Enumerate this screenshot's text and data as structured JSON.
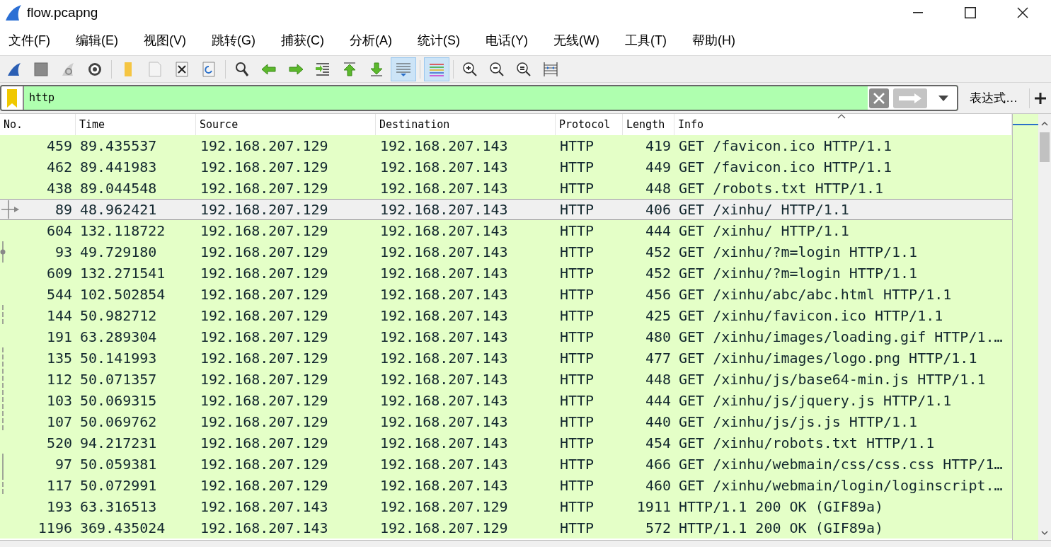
{
  "window": {
    "title": "flow.pcapng"
  },
  "menu": [
    "文件(F)",
    "编辑(E)",
    "视图(V)",
    "跳转(G)",
    "捕获(C)",
    "分析(A)",
    "统计(S)",
    "电话(Y)",
    "无线(W)",
    "工具(T)",
    "帮助(H)"
  ],
  "toolbar": [
    {
      "kind": "fin",
      "pressed": false
    },
    {
      "kind": "stop",
      "pressed": false
    },
    {
      "kind": "restart",
      "pressed": false
    },
    {
      "kind": "options",
      "pressed": false
    },
    {
      "kind": "separator"
    },
    {
      "kind": "open",
      "pressed": false
    },
    {
      "kind": "file",
      "pressed": false
    },
    {
      "kind": "close",
      "pressed": false
    },
    {
      "kind": "reload",
      "pressed": false
    },
    {
      "kind": "separator"
    },
    {
      "kind": "find",
      "pressed": false
    },
    {
      "kind": "back",
      "pressed": false
    },
    {
      "kind": "forward",
      "pressed": false
    },
    {
      "kind": "goto",
      "pressed": false
    },
    {
      "kind": "first",
      "pressed": false
    },
    {
      "kind": "last",
      "pressed": false
    },
    {
      "kind": "autoscroll",
      "pressed": true
    },
    {
      "kind": "separator"
    },
    {
      "kind": "colorize",
      "pressed": true
    },
    {
      "kind": "separator"
    },
    {
      "kind": "zoom-in",
      "pressed": false
    },
    {
      "kind": "zoom-out",
      "pressed": false
    },
    {
      "kind": "zoom-reset",
      "pressed": false
    },
    {
      "kind": "resize",
      "pressed": false
    }
  ],
  "filter": {
    "value": "http",
    "valid": true,
    "expression_button": "表达式…"
  },
  "table": {
    "columns": [
      {
        "label": "No."
      },
      {
        "label": "Time"
      },
      {
        "label": "Source"
      },
      {
        "label": "Destination"
      },
      {
        "label": "Protocol"
      },
      {
        "label": "Length"
      },
      {
        "label": "Info",
        "sorted": true
      }
    ],
    "rows": [
      {
        "no": "459",
        "time": "89.435537",
        "source": "192.168.207.129",
        "destination": "192.168.207.143",
        "protocol": "HTTP",
        "length": "419",
        "info": "GET /favicon.ico HTTP/1.1",
        "selected": false
      },
      {
        "no": "462",
        "time": "89.441983",
        "source": "192.168.207.129",
        "destination": "192.168.207.143",
        "protocol": "HTTP",
        "length": "449",
        "info": "GET /favicon.ico HTTP/1.1",
        "selected": false
      },
      {
        "no": "438",
        "time": "89.044548",
        "source": "192.168.207.129",
        "destination": "192.168.207.143",
        "protocol": "HTTP",
        "length": "448",
        "info": "GET /robots.txt HTTP/1.1",
        "selected": false
      },
      {
        "no": "89",
        "time": "48.962421",
        "source": "192.168.207.129",
        "destination": "192.168.207.143",
        "protocol": "HTTP",
        "length": "406",
        "info": "GET /xinhu/ HTTP/1.1",
        "selected": true,
        "kind": "arrow"
      },
      {
        "no": "604",
        "time": "132.118722",
        "source": "192.168.207.129",
        "destination": "192.168.207.143",
        "protocol": "HTTP",
        "length": "444",
        "info": "GET /xinhu/ HTTP/1.1",
        "selected": false
      },
      {
        "no": "93",
        "time": "49.729180",
        "source": "192.168.207.129",
        "destination": "192.168.207.143",
        "protocol": "HTTP",
        "length": "452",
        "info": "GET /xinhu/?m=login HTTP/1.1",
        "selected": false,
        "kind": "dot"
      },
      {
        "no": "609",
        "time": "132.271541",
        "source": "192.168.207.129",
        "destination": "192.168.207.143",
        "protocol": "HTTP",
        "length": "452",
        "info": "GET /xinhu/?m=login HTTP/1.1",
        "selected": false
      },
      {
        "no": "544",
        "time": "102.502854",
        "source": "192.168.207.129",
        "destination": "192.168.207.143",
        "protocol": "HTTP",
        "length": "456",
        "info": "GET /xinhu/abc/abc.html HTTP/1.1",
        "selected": false
      },
      {
        "no": "144",
        "time": "50.982712",
        "source": "192.168.207.129",
        "destination": "192.168.207.143",
        "protocol": "HTTP",
        "length": "425",
        "info": "GET /xinhu/favicon.ico HTTP/1.1",
        "selected": false,
        "kind": "dashed"
      },
      {
        "no": "191",
        "time": "63.289304",
        "source": "192.168.207.129",
        "destination": "192.168.207.143",
        "protocol": "HTTP",
        "length": "480",
        "info": "GET /xinhu/images/loading.gif HTTP/1.…",
        "selected": false
      },
      {
        "no": "135",
        "time": "50.141993",
        "source": "192.168.207.129",
        "destination": "192.168.207.143",
        "protocol": "HTTP",
        "length": "477",
        "info": "GET /xinhu/images/logo.png HTTP/1.1",
        "selected": false,
        "kind": "dashed"
      },
      {
        "no": "112",
        "time": "50.071357",
        "source": "192.168.207.129",
        "destination": "192.168.207.143",
        "protocol": "HTTP",
        "length": "448",
        "info": "GET /xinhu/js/base64-min.js HTTP/1.1",
        "selected": false,
        "kind": "dashed"
      },
      {
        "no": "103",
        "time": "50.069315",
        "source": "192.168.207.129",
        "destination": "192.168.207.143",
        "protocol": "HTTP",
        "length": "444",
        "info": "GET /xinhu/js/jquery.js HTTP/1.1",
        "selected": false,
        "kind": "dashed"
      },
      {
        "no": "107",
        "time": "50.069762",
        "source": "192.168.207.129",
        "destination": "192.168.207.143",
        "protocol": "HTTP",
        "length": "440",
        "info": "GET /xinhu/js/js.js HTTP/1.1",
        "selected": false,
        "kind": "dashed"
      },
      {
        "no": "520",
        "time": "94.217231",
        "source": "192.168.207.129",
        "destination": "192.168.207.143",
        "protocol": "HTTP",
        "length": "454",
        "info": "GET /xinhu/robots.txt HTTP/1.1",
        "selected": false
      },
      {
        "no": "97",
        "time": "50.059381",
        "source": "192.168.207.129",
        "destination": "192.168.207.143",
        "protocol": "HTTP",
        "length": "466",
        "info": "GET /xinhu/webmain/css/css.css HTTP/1…",
        "selected": false,
        "kind": "solid"
      },
      {
        "no": "117",
        "time": "50.072991",
        "source": "192.168.207.129",
        "destination": "192.168.207.143",
        "protocol": "HTTP",
        "length": "460",
        "info": "GET /xinhu/webmain/login/loginscript.…",
        "selected": false,
        "kind": "dashed"
      },
      {
        "no": "193",
        "time": "63.316513",
        "source": "192.168.207.143",
        "destination": "192.168.207.129",
        "protocol": "HTTP",
        "length": "1911",
        "info": "HTTP/1.1 200 OK  (GIF89a)",
        "selected": false
      },
      {
        "no": "1196",
        "time": "369.435024",
        "source": "192.168.207.143",
        "destination": "192.168.207.129",
        "protocol": "HTTP",
        "length": "572",
        "info": "HTTP/1.1 200 OK  (GIF89a)",
        "selected": false
      }
    ]
  }
}
